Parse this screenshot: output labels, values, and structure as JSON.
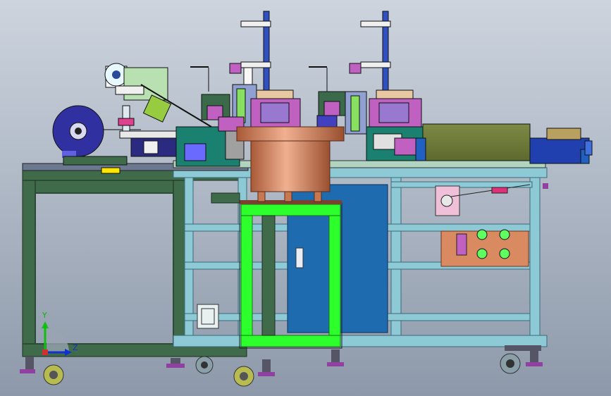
{
  "view": {
    "background_top": "#c9d1dc",
    "background_bottom": "#8e9aab"
  },
  "colors": {
    "frame_green": "#3f6b4a",
    "frame_blue": "#8ec9d6",
    "bright_green": "#2cff2c",
    "copper": "#c87850",
    "cabinet_blue": "#1f6bb0",
    "olive": "#6e7a3a",
    "magenta": "#c060c0",
    "reel_blue": "#3030a0",
    "salmon": "#d98a60",
    "pale_green": "#b8e0b0"
  },
  "triad": {
    "y_label": "Y",
    "z_label": "Z"
  }
}
